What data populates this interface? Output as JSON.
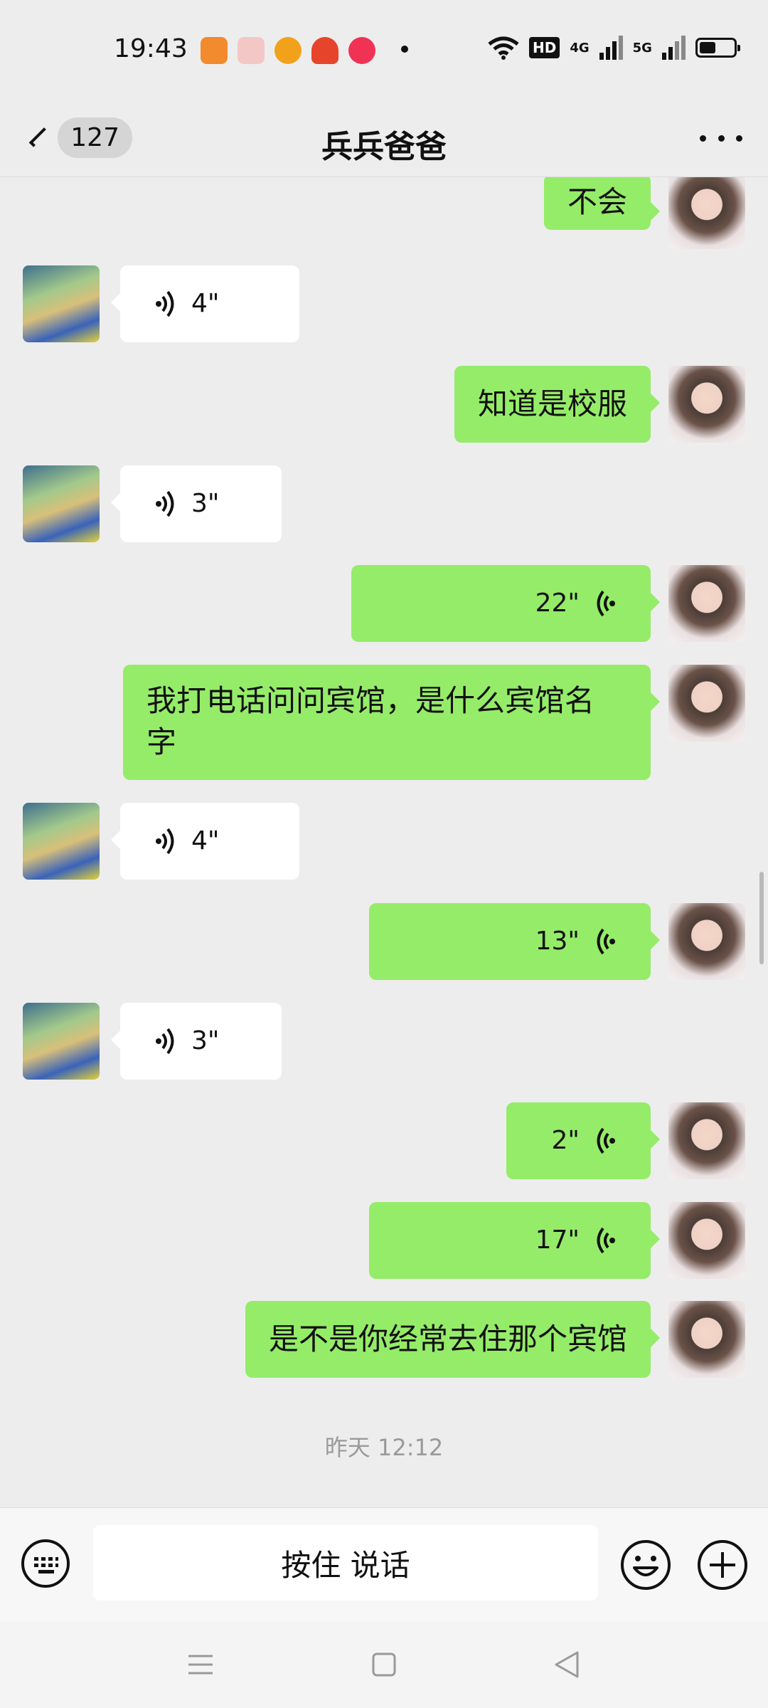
{
  "status_bar": {
    "time": "19:43",
    "network_badge": "HD",
    "signal_1_label": "4G",
    "signal_2_label": "5G"
  },
  "header": {
    "unread_count": "127",
    "title": "兵兵爸爸"
  },
  "messages": [
    {
      "side": "self",
      "kind": "text",
      "text": "不会"
    },
    {
      "side": "partner",
      "kind": "voice",
      "duration": "4\""
    },
    {
      "side": "self",
      "kind": "text",
      "text": "知道是校服"
    },
    {
      "side": "partner",
      "kind": "voice",
      "duration": "3\""
    },
    {
      "side": "self",
      "kind": "voice",
      "duration": "22\""
    },
    {
      "side": "self",
      "kind": "text",
      "text_line1": "我打电话问问宾馆，是什么宾馆名",
      "text_line2": "字"
    },
    {
      "side": "partner",
      "kind": "voice",
      "duration": "4\""
    },
    {
      "side": "self",
      "kind": "voice",
      "duration": "13\""
    },
    {
      "side": "partner",
      "kind": "voice",
      "duration": "3\""
    },
    {
      "side": "self",
      "kind": "voice",
      "duration": "2\""
    },
    {
      "side": "self",
      "kind": "voice",
      "duration": "17\""
    },
    {
      "side": "self",
      "kind": "text",
      "text": "是不是你经常去住那个宾馆"
    }
  ],
  "timestamp": "昨天 12:12",
  "input_bar": {
    "hold_to_talk": "按住 说话"
  },
  "colors": {
    "outgoing_bubble": "#95ec69",
    "incoming_bubble": "#ffffff",
    "background": "#ededed"
  }
}
